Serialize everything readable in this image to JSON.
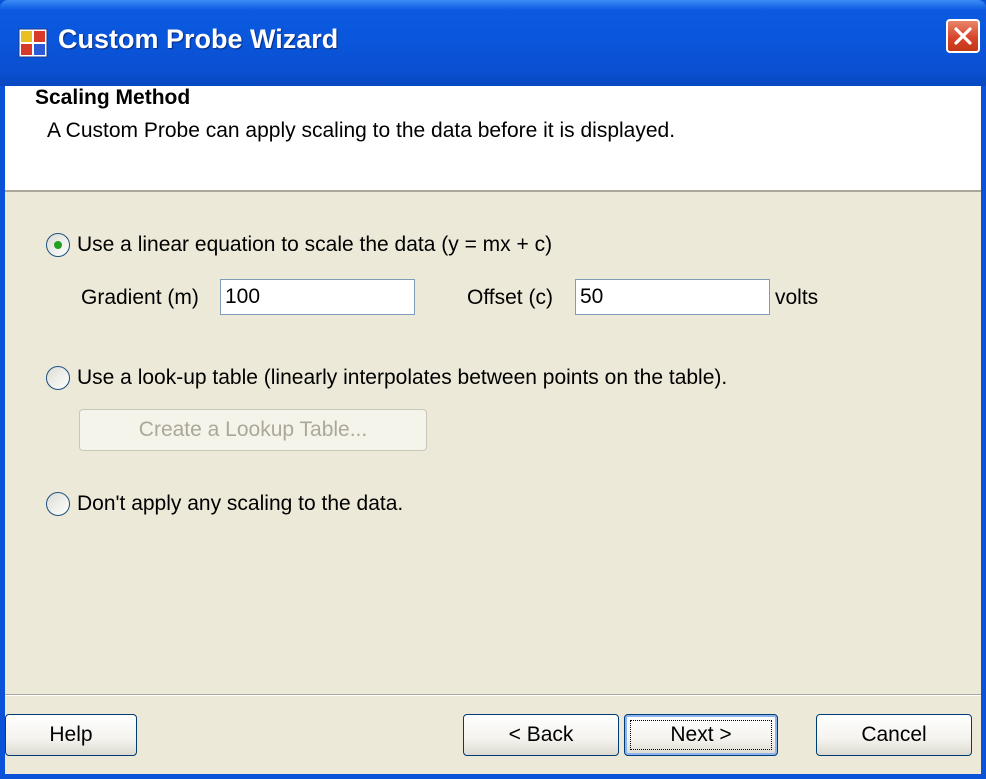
{
  "window": {
    "title": "Custom Probe Wizard",
    "icon": "app-window-icon",
    "close_icon": "close-icon"
  },
  "header": {
    "title": "Scaling Method",
    "subtitle": "A Custom Probe can apply scaling to the data before it is displayed."
  },
  "options": {
    "linear": {
      "label": "Use a linear equation to scale the data (y = mx + c)",
      "selected": true,
      "gradient_label": "Gradient (m)",
      "gradient_value": "100",
      "offset_label": "Offset (c)",
      "offset_value": "50",
      "unit_label": "volts"
    },
    "lookup": {
      "label": "Use a look-up table (linearly interpolates between points on the table).",
      "selected": false,
      "button_label": "Create a Lookup Table..."
    },
    "none": {
      "label": "Don't apply any scaling to the data.",
      "selected": false
    }
  },
  "footer": {
    "help_label": "Help",
    "back_label": "< Back",
    "next_label": "Next >",
    "cancel_label": "Cancel"
  },
  "colors": {
    "titlebar": "#0a56dc",
    "dialog_bg": "#ece9d8",
    "close_button": "#d9462a",
    "radio_dot": "#21a121"
  }
}
